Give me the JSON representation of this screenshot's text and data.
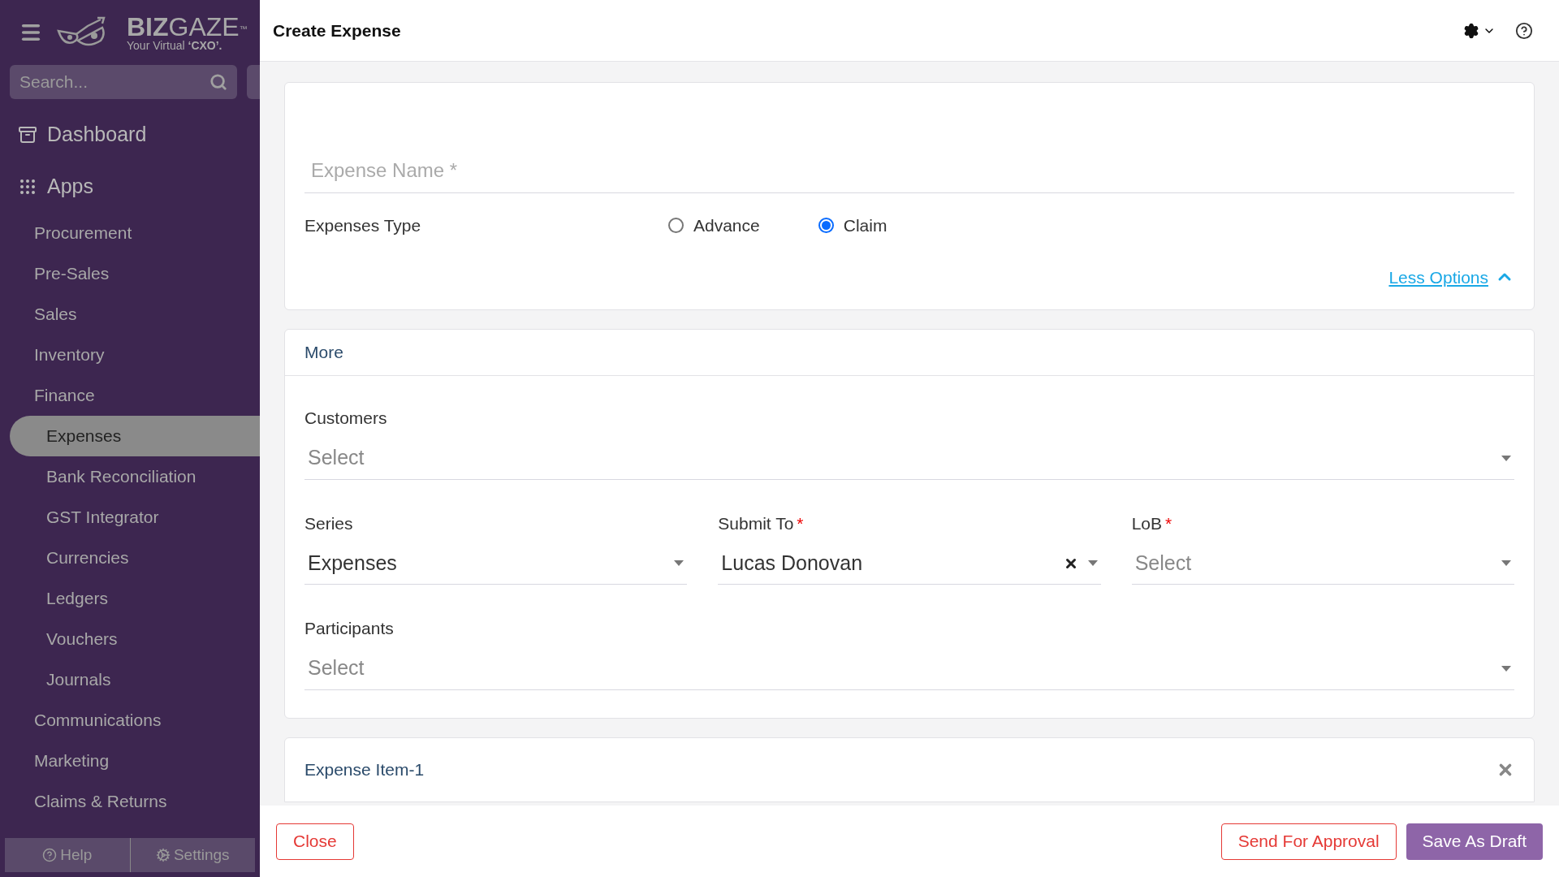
{
  "sidebar": {
    "brand": {
      "name_bold": "BIZ",
      "name_light": "GAZE",
      "trademark": "™",
      "tagline": "Your Virtual ",
      "tagline_bold": "‘CXO’."
    },
    "search": {
      "placeholder": "Search..."
    },
    "nav": [
      {
        "label": "Dashboard",
        "kind": "dashboard"
      },
      {
        "label": "Apps",
        "kind": "apps",
        "children": [
          {
            "label": "Procurement",
            "selected": false
          },
          {
            "label": "Pre-Sales",
            "selected": false
          },
          {
            "label": "Sales",
            "selected": false
          },
          {
            "label": "Inventory",
            "selected": false
          },
          {
            "label": "Finance",
            "selected": false,
            "children": [
              {
                "label": "Expenses",
                "selected": true
              },
              {
                "label": "Bank Reconciliation",
                "selected": false
              },
              {
                "label": "GST Integrator",
                "selected": false
              },
              {
                "label": "Currencies",
                "selected": false
              },
              {
                "label": "Ledgers",
                "selected": false
              },
              {
                "label": "Vouchers",
                "selected": false
              },
              {
                "label": "Journals",
                "selected": false
              }
            ]
          },
          {
            "label": "Communications",
            "selected": false
          },
          {
            "label": "Marketing",
            "selected": false
          },
          {
            "label": "Claims & Returns",
            "selected": false
          }
        ]
      }
    ],
    "footer": [
      {
        "label": "Help",
        "kind": "help"
      },
      {
        "label": "Settings",
        "kind": "settings"
      }
    ]
  },
  "header": {
    "title": "Create Expense"
  },
  "form": {
    "expense_name": {
      "placeholder": "Expense Name *"
    },
    "expenses_type": {
      "label": "Expenses Type",
      "options": [
        {
          "label": "Advance",
          "selected": false
        },
        {
          "label": "Claim",
          "selected": true
        }
      ]
    },
    "less_options": "Less Options",
    "more": {
      "title": "More",
      "rows": [
        [
          {
            "label": "Customers",
            "placeholder": "Select",
            "clearable": false
          }
        ],
        [
          {
            "label": "Series",
            "value": "Expenses",
            "clearable": false
          },
          {
            "label": "Submit To",
            "required_mark": "*",
            "value": "Lucas Donovan",
            "clearable": true
          },
          {
            "label": "LoB",
            "required_mark": "*",
            "placeholder": "Select",
            "clearable": false
          }
        ],
        [
          {
            "label": "Participants",
            "placeholder": "Select",
            "clearable": false
          }
        ]
      ]
    },
    "expense_item": {
      "title": "Expense Item-1"
    }
  },
  "footer_buttons": {
    "left": [
      {
        "label": "Close",
        "kind": "outline"
      }
    ],
    "right": [
      {
        "label": "Send For Approval",
        "kind": "outline"
      },
      {
        "label": "Save As Draft",
        "kind": "primary"
      }
    ]
  }
}
